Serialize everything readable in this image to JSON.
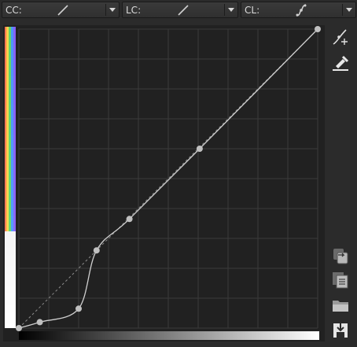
{
  "toolbar": {
    "combos": [
      {
        "label": "CC:",
        "icon": "linear-curve-icon"
      },
      {
        "label": "LC:",
        "icon": "linear-curve-icon"
      },
      {
        "label": "CL:",
        "icon": "custom-curve-icon"
      }
    ]
  },
  "curve_editor": {
    "grid_divisions": 10,
    "control_points": [
      {
        "input": 0.0,
        "output": 0.0
      },
      {
        "input": 0.07,
        "output": 0.02
      },
      {
        "input": 0.2,
        "output": 0.065
      },
      {
        "input": 0.26,
        "output": 0.26
      },
      {
        "input": 0.37,
        "output": 0.365
      },
      {
        "input": 0.605,
        "output": 0.6
      },
      {
        "input": 1.0,
        "output": 1.0
      }
    ],
    "identity_line": "dashed",
    "colors": {
      "background": "#212121",
      "grid": "#3a3a3a",
      "curve": "#cfcfcf",
      "point": "#c0c0c0"
    }
  },
  "side_buttons": [
    {
      "icon": "add-point-icon"
    },
    {
      "icon": "eyedropper-icon"
    },
    {
      "icon": "link-channels-icon"
    },
    {
      "icon": "copy-icon"
    },
    {
      "icon": "open-folder-icon"
    },
    {
      "icon": "save-icon"
    }
  ]
}
